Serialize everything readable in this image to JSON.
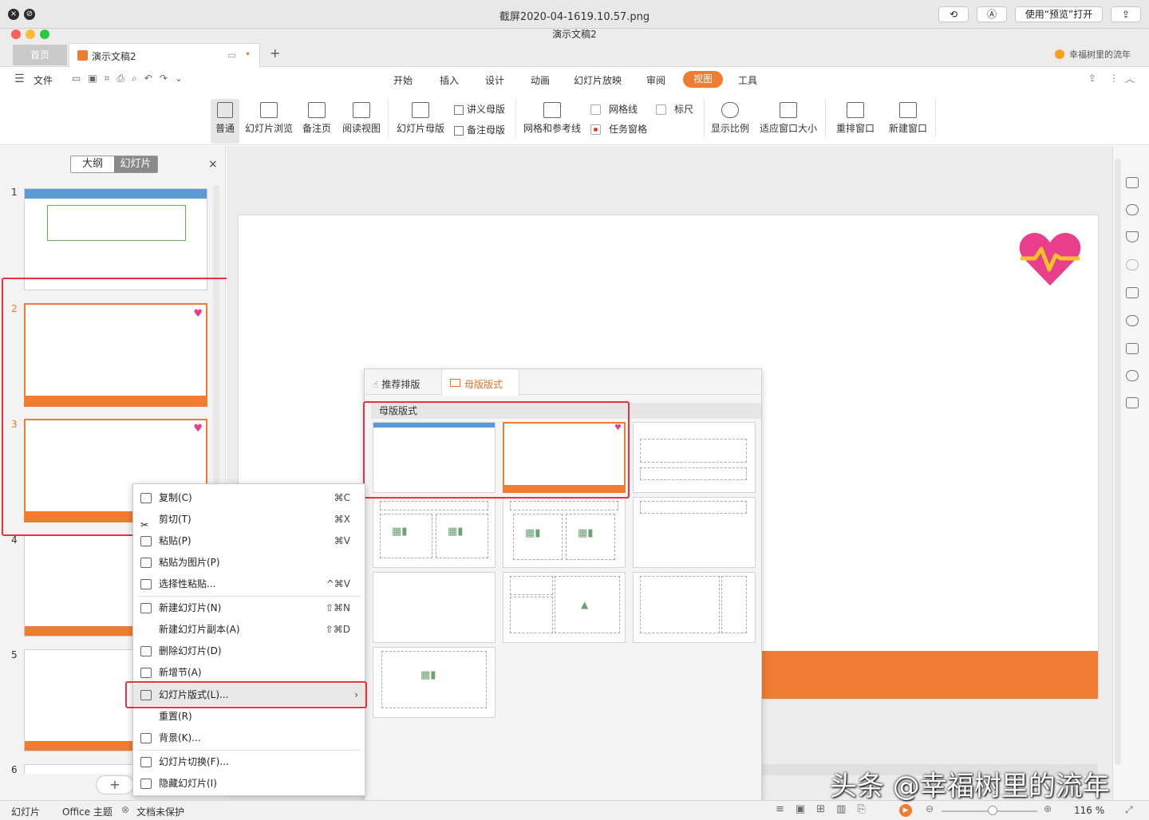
{
  "titlebar": {
    "filename": "截屏2020-04-1619.10.57.png",
    "open_with": "使用“预览”打开"
  },
  "wps": {
    "doc_title": "演示文稿2",
    "tab_home": "首页",
    "tab_doc": "演示文稿2",
    "tab_add": "+",
    "user": "幸福树里的流年"
  },
  "menu": {
    "file": "文件",
    "items": [
      "开始",
      "插入",
      "设计",
      "动画",
      "幻灯片放映",
      "审阅",
      "视图",
      "工具"
    ],
    "active": "视图"
  },
  "ribbon": {
    "normal": "普通",
    "browse": "幻灯片浏览",
    "notes": "备注页",
    "reading": "阅读视图",
    "slide_master": "幻灯片母版",
    "handout_master": "讲义母版",
    "notes_master": "备注母版",
    "grid_guides": "网格和参考线",
    "gridlines": "网格线",
    "ruler": "标尺",
    "task_pane": "任务窗格",
    "zoom": "显示比例",
    "fit_window": "适应窗口大小",
    "arrange": "重排窗口",
    "new_window": "新建窗口"
  },
  "panel": {
    "tab_outline": "大纲",
    "tab_slides": "幻灯片",
    "close": "×",
    "numbers": [
      "1",
      "2",
      "3",
      "4",
      "5",
      "6"
    ],
    "add": "+"
  },
  "context_menu": [
    {
      "label": "复制(C)",
      "shortcut": "⌘C"
    },
    {
      "label": "剪切(T)",
      "shortcut": "⌘X"
    },
    {
      "label": "粘贴(P)",
      "shortcut": "⌘V"
    },
    {
      "label": "粘贴为图片(P)",
      "shortcut": ""
    },
    {
      "label": "选择性粘贴...",
      "shortcut": "^⌘V"
    },
    {
      "label": "新建幻灯片(N)",
      "shortcut": "⇧⌘N"
    },
    {
      "label": "新建幻灯片副本(A)",
      "shortcut": "⇧⌘D"
    },
    {
      "label": "删除幻灯片(D)",
      "shortcut": ""
    },
    {
      "label": "新增节(A)",
      "shortcut": ""
    },
    {
      "label": "幻灯片版式(L)...",
      "shortcut": "›"
    },
    {
      "label": "重置(R)",
      "shortcut": ""
    },
    {
      "label": "背景(K)...",
      "shortcut": ""
    },
    {
      "label": "幻灯片切换(F)...",
      "shortcut": ""
    },
    {
      "label": "隐藏幻灯片(I)",
      "shortcut": ""
    }
  ],
  "layout_panel": {
    "tab_recommend": "推荐排版",
    "tab_master": "母版版式",
    "section": "母版版式"
  },
  "status": {
    "slides": "幻灯片",
    "theme": "Office 主题",
    "protect": "文档未保护",
    "zoom": "116 %"
  },
  "watermark": "头条 @幸福树里的流年",
  "colors": {
    "accent": "#ef7d31",
    "highlight": "#e5343e",
    "heart": "#e83e8c"
  }
}
